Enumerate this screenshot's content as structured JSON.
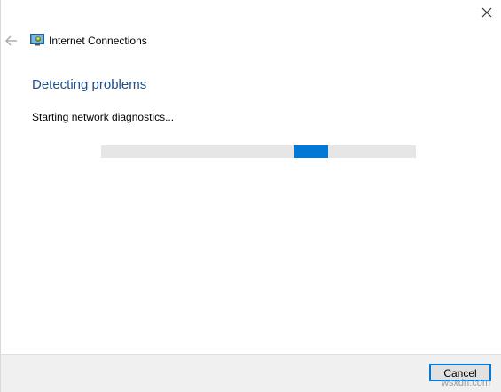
{
  "window": {
    "title": "Internet Connections"
  },
  "main": {
    "heading": "Detecting problems",
    "status": "Starting network diagnostics...",
    "progress": {
      "mode": "indeterminate",
      "chunk_position_percent": 61,
      "accent_color": "#0078d7"
    }
  },
  "footer": {
    "cancel_label": "Cancel"
  },
  "watermark": "wsxdn.com",
  "icons": {
    "close": "close-icon",
    "back": "back-arrow-icon",
    "app": "network-troubleshooter-icon"
  },
  "colors": {
    "heading": "#1e4e8c",
    "accent": "#0078d7",
    "footer_bg": "#f0f0f0"
  }
}
